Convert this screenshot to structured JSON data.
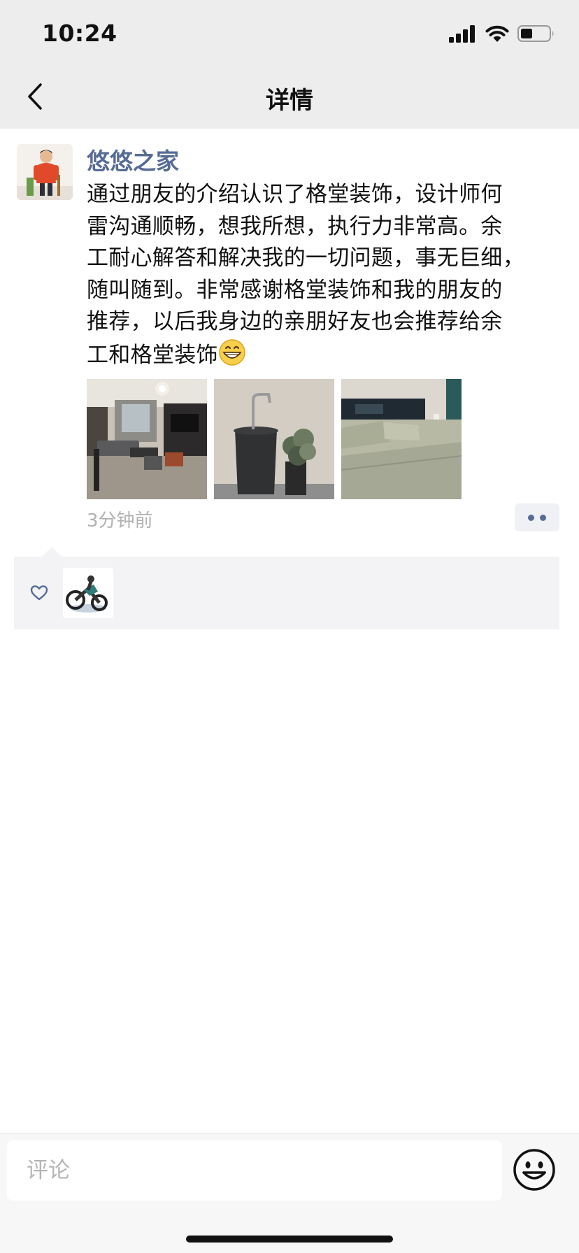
{
  "status_bar": {
    "time": "10:24",
    "icons": [
      "cellular-signal-icon",
      "wifi-icon",
      "battery-icon"
    ]
  },
  "nav": {
    "back_icon": "chevron-left-icon",
    "title": "详情"
  },
  "post": {
    "author": "悠悠之家",
    "content_lines": [
      "通过朋友的介绍认识了格堂装饰，设计师何",
      "雷沟通顺畅，想我所想，执行力非常高。余",
      "工耐心解答和解决我的一切问题，事无巨细，",
      "随叫随到。非常感谢格堂装饰和我的朋友的",
      "推荐，以后我身边的亲朋好友也会推荐给余",
      "工和格堂装饰"
    ],
    "content_emoji": "grinning-face-emoji",
    "photos": [
      {
        "name": "living-room-photo"
      },
      {
        "name": "washbasin-photo"
      },
      {
        "name": "bedroom-photo"
      }
    ],
    "time": "3分钟前",
    "more_icon": "two-dots-icon"
  },
  "likes": {
    "heart_icon": "heart-outline-icon",
    "likers": [
      {
        "avatar": "motorcycle-avatar"
      }
    ]
  },
  "comment_bar": {
    "placeholder": "评论",
    "emoji_icon": "smiley-face-icon"
  },
  "colors": {
    "header_bg": "#ededed",
    "link_blue": "#576b95",
    "secondary_text": "#b2b2b2",
    "likes_bg": "#f3f3f5"
  }
}
